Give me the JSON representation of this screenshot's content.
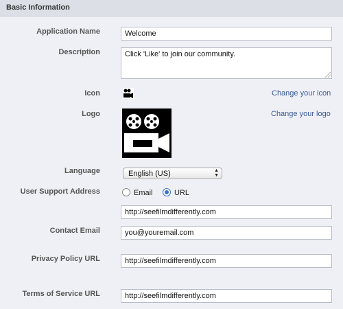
{
  "section": {
    "title": "Basic Information"
  },
  "labels": {
    "app_name": "Application Name",
    "description": "Description",
    "icon": "Icon",
    "logo": "Logo",
    "language": "Language",
    "support_address": "User Support Address",
    "contact_email": "Contact Email",
    "privacy_policy": "Privacy Policy URL",
    "terms_of_service": "Terms of Service URL"
  },
  "values": {
    "app_name": "Welcome",
    "description": "Click 'Like' to join our community.",
    "language": "English (US)",
    "support_url": "http://seefilmdifferently.com",
    "contact_email": "you@youremail.com",
    "privacy_policy_url": "http://seefilmdifferently.com",
    "terms_of_service_url": "http://seefilmdifferently.com"
  },
  "links": {
    "change_icon": "Change your icon",
    "change_logo": "Change your logo"
  },
  "support_options": [
    {
      "label": "Email",
      "checked": false
    },
    {
      "label": "URL",
      "checked": true
    }
  ],
  "icons": {
    "app_icon": "film-camera-icon",
    "logo": "film-camera-logo",
    "select_arrows": "updown-arrows-icon"
  },
  "colors": {
    "link": "#3b5998",
    "radio_selected": "#3a74c8",
    "header_bg": "#dcdfe6",
    "page_bg": "#eef0f5"
  }
}
